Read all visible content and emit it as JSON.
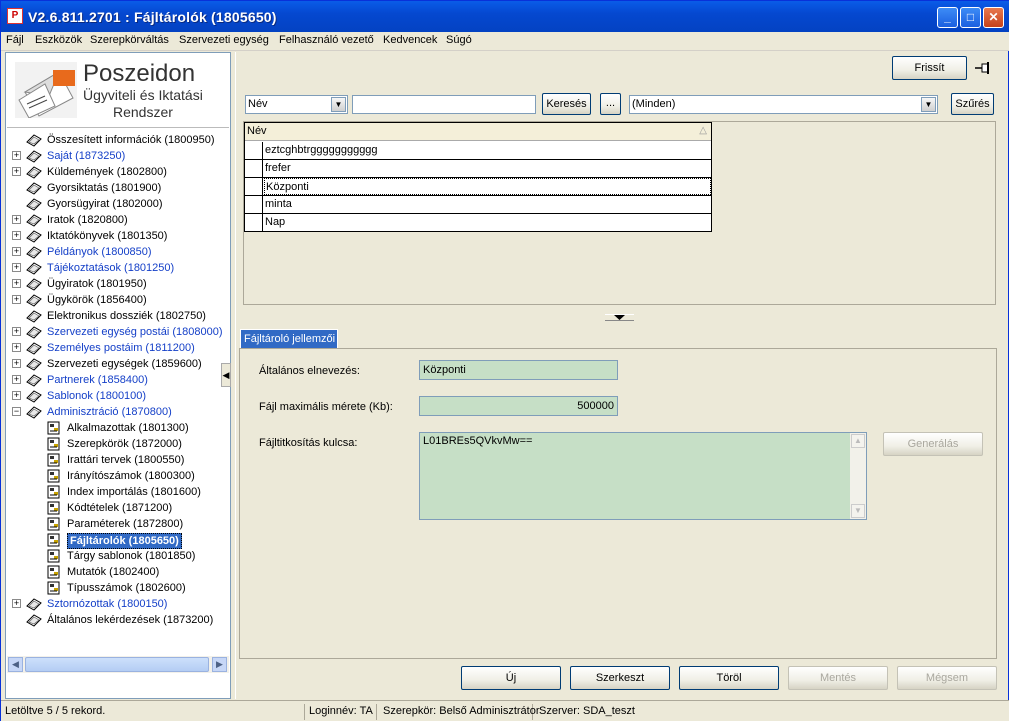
{
  "window": {
    "title": "V2.6.811.2701 : Fájltárolók (1805650)"
  },
  "menu": [
    "Fájl",
    "Eszközök",
    "Szerepkörváltás",
    "Szervezeti egység",
    "Felhasználó vezető",
    "Kedvencek",
    "Súgó"
  ],
  "logo": {
    "name": "Poszeidon",
    "line2": "Ügyviteli és Iktatási",
    "line3": "Rendszer"
  },
  "tree": [
    {
      "label": "Összesített információk (1800950)",
      "expandable": false,
      "blue": false
    },
    {
      "label": "Saját (1873250)",
      "expandable": true,
      "blue": true
    },
    {
      "label": "Küldemények (1802800)",
      "expandable": true,
      "blue": false
    },
    {
      "label": "Gyorsiktatás (1801900)",
      "expandable": false,
      "blue": false
    },
    {
      "label": "Gyorsügyirat (1802000)",
      "expandable": false,
      "blue": false
    },
    {
      "label": "Iratok (1820800)",
      "expandable": true,
      "blue": false
    },
    {
      "label": "Iktatókönyvek (1801350)",
      "expandable": true,
      "blue": false
    },
    {
      "label": "Példányok (1800850)",
      "expandable": true,
      "blue": true
    },
    {
      "label": "Tájékoztatások (1801250)",
      "expandable": true,
      "blue": true
    },
    {
      "label": "Ügyiratok (1801950)",
      "expandable": true,
      "blue": false
    },
    {
      "label": "Ügykörök (1856400)",
      "expandable": true,
      "blue": false
    },
    {
      "label": "Elektronikus dossziék (1802750)",
      "expandable": false,
      "blue": false
    },
    {
      "label": "Szervezeti egység postái (1808000)",
      "expandable": true,
      "blue": true
    },
    {
      "label": "Személyes postáim (1811200)",
      "expandable": true,
      "blue": true
    },
    {
      "label": "Szervezeti egységek (1859600)",
      "expandable": true,
      "blue": false
    },
    {
      "label": "Partnerek (1858400)",
      "expandable": true,
      "blue": true
    },
    {
      "label": "Sablonok (1800100)",
      "expandable": true,
      "blue": true
    },
    {
      "label": "Adminisztráció (1870800)",
      "expandable": true,
      "expanded": true,
      "blue": true
    },
    {
      "label": "Alkalmazottak (1801300)",
      "child": true
    },
    {
      "label": "Szerepkörök (1872000)",
      "child": true
    },
    {
      "label": "Irattári tervek (1800550)",
      "child": true
    },
    {
      "label": "Irányítószámok (1800300)",
      "child": true
    },
    {
      "label": "Index importálás (1801600)",
      "child": true
    },
    {
      "label": "Kódtételek (1871200)",
      "child": true
    },
    {
      "label": "Paraméterek (1872800)",
      "child": true
    },
    {
      "label": "Fájltárolók (1805650)",
      "child": true,
      "selected": true
    },
    {
      "label": "Tárgy sablonok (1801850)",
      "child": true
    },
    {
      "label": "Mutatók (1802400)",
      "child": true
    },
    {
      "label": "Típusszámok (1802600)",
      "child": true
    },
    {
      "label": "Sztornózottak (1800150)",
      "expandable": true,
      "blue": true
    },
    {
      "label": "Általános lekérdezések (1873200)",
      "expandable": false,
      "blue": false
    }
  ],
  "toolbar": {
    "refresh": "Frissít"
  },
  "search": {
    "field": "Név",
    "value": "",
    "search_btn": "Keresés",
    "more_btn": "...",
    "filter": "(Minden)",
    "filter_btn": "Szűrés"
  },
  "grid": {
    "column": "Név",
    "rows": [
      "eztcghbtrggggggggggg",
      "frefer",
      "Központi",
      "minta",
      "Nap"
    ],
    "current_index": 2
  },
  "tab": {
    "label": "Fájltároló jellemzői"
  },
  "form": {
    "name_label": "Általános elnevezés:",
    "name_value": "Központi",
    "size_label": "Fájl maximális mérete (Kb):",
    "size_value": "500000",
    "key_label": "Fájltitkosítás kulcsa:",
    "key_value": "L01BREs5QVkvMw==",
    "generate_btn": "Generálás"
  },
  "actions": {
    "new": "Új",
    "edit": "Szerkeszt",
    "delete": "Töröl",
    "save": "Mentés",
    "cancel": "Mégsem"
  },
  "status": {
    "records": "Letöltve 5 / 5 rekord.",
    "login": "Loginnév: TA",
    "role": "Szerepkör: Belső Adminisztrátor",
    "server": "Szerver: SDA_teszt"
  }
}
